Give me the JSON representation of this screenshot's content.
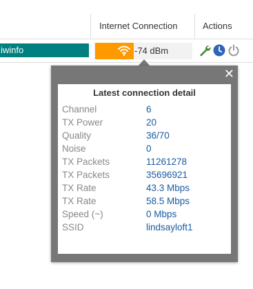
{
  "table": {
    "headers": {
      "internet_connection": "Internet Connection",
      "actions": "Actions"
    },
    "row": {
      "name": "iwinfo",
      "signal": "-74 dBm",
      "signal_level_percent": 40,
      "signal_color": "#ff9900",
      "name_color": "#008080",
      "actions": [
        "wrench-icon",
        "clock-icon",
        "power-icon"
      ]
    }
  },
  "popup": {
    "close": "✕",
    "title": "Latest connection detail",
    "details": [
      {
        "label": "Channel",
        "value": "6"
      },
      {
        "label": "TX Power",
        "value": "20"
      },
      {
        "label": "Quality",
        "value": "36/70"
      },
      {
        "label": "Noise",
        "value": "0"
      },
      {
        "label": "TX Packets",
        "value": "11261278"
      },
      {
        "label": "TX Packets",
        "value": "35696921"
      },
      {
        "label": "TX Rate",
        "value": "43.3 Mbps"
      },
      {
        "label": "TX Rate",
        "value": "58.5 Mbps"
      },
      {
        "label": "Speed (~)",
        "value": "0 Mbps"
      },
      {
        "label": "SSID",
        "value": "lindsayloft1"
      }
    ]
  }
}
